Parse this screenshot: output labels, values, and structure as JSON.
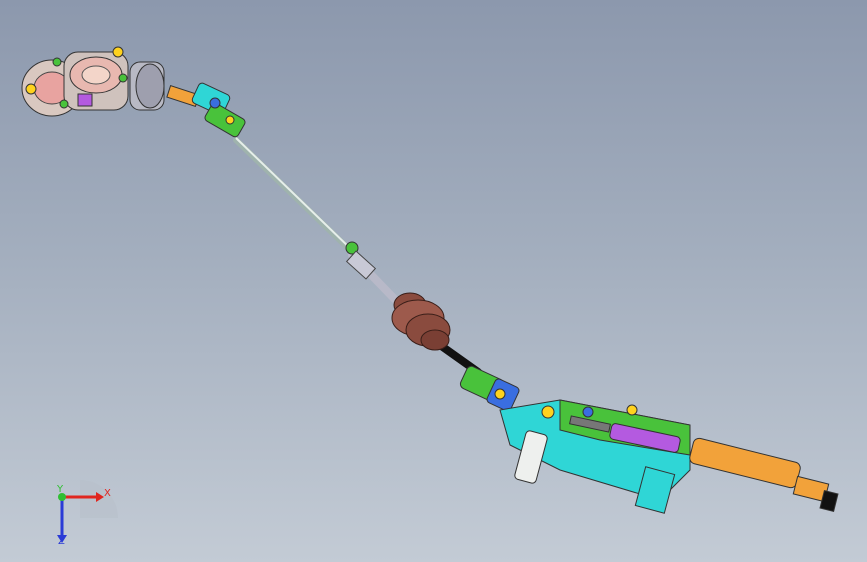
{
  "scene": {
    "background_top": "#8c98ad",
    "background_bottom": "#c3cbd5"
  },
  "triad": {
    "x_label": "X",
    "y_label": "Y",
    "z_label": "Z",
    "x_color": "#e0261f",
    "y_color": "#2fbf32",
    "z_color": "#2a3bd6"
  },
  "colors": {
    "housing_pink": "#e8a3a0",
    "green_part": "#49c23b",
    "cyan_part": "#2fd6d6",
    "blue_part": "#3a6ee0",
    "orange_shaft": "#f2a23a",
    "purple_part": "#b45ae0",
    "boot_brown": "#8a4b3e",
    "shaft_grey": "#c9d3cf",
    "black": "#111111"
  }
}
